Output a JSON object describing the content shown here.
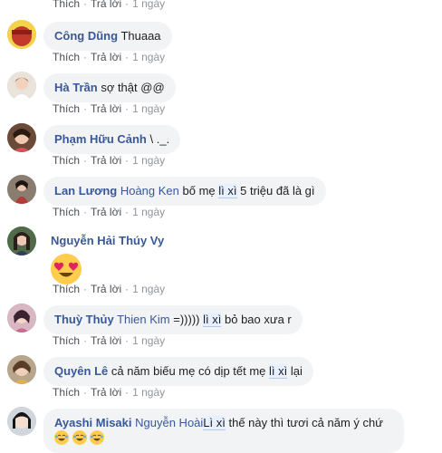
{
  "actions": {
    "like": "Thích",
    "reply": "Trả lời",
    "time": "1 ngày"
  },
  "comments": [
    {
      "author": "Công Dũng",
      "text": "Thuaaa"
    },
    {
      "author": "Hà Trần",
      "text": "sợ thật @@"
    },
    {
      "author": "Phạm Hữu Cảnh",
      "text": "\\ ._."
    },
    {
      "author": "Lan Lương",
      "tag": "Hoàng Ken",
      "pre": "bố mẹ",
      "hl": "lì xì",
      "post": "5 triệu đã là gì"
    },
    {
      "author": "Nguyễn Hải Thúy Vy",
      "emoji": "heart-eyes-emoji"
    },
    {
      "author": "Thuỳ Thủy",
      "tag": "Thien Kim",
      "pre": "=)))))",
      "hl": "lì xì",
      "post": "bỏ bao xưa r"
    },
    {
      "author": "Quyên Lê",
      "pre": "cả năm biếu mẹ có dịp tết mẹ",
      "hl": "lì xì",
      "post": "lại"
    },
    {
      "author": "Ayashi Misaki",
      "tag": "Nguyễn Hoài",
      "hl": "Lì xì",
      "post": "thế này thì tươi cả năm ý chứ"
    }
  ]
}
